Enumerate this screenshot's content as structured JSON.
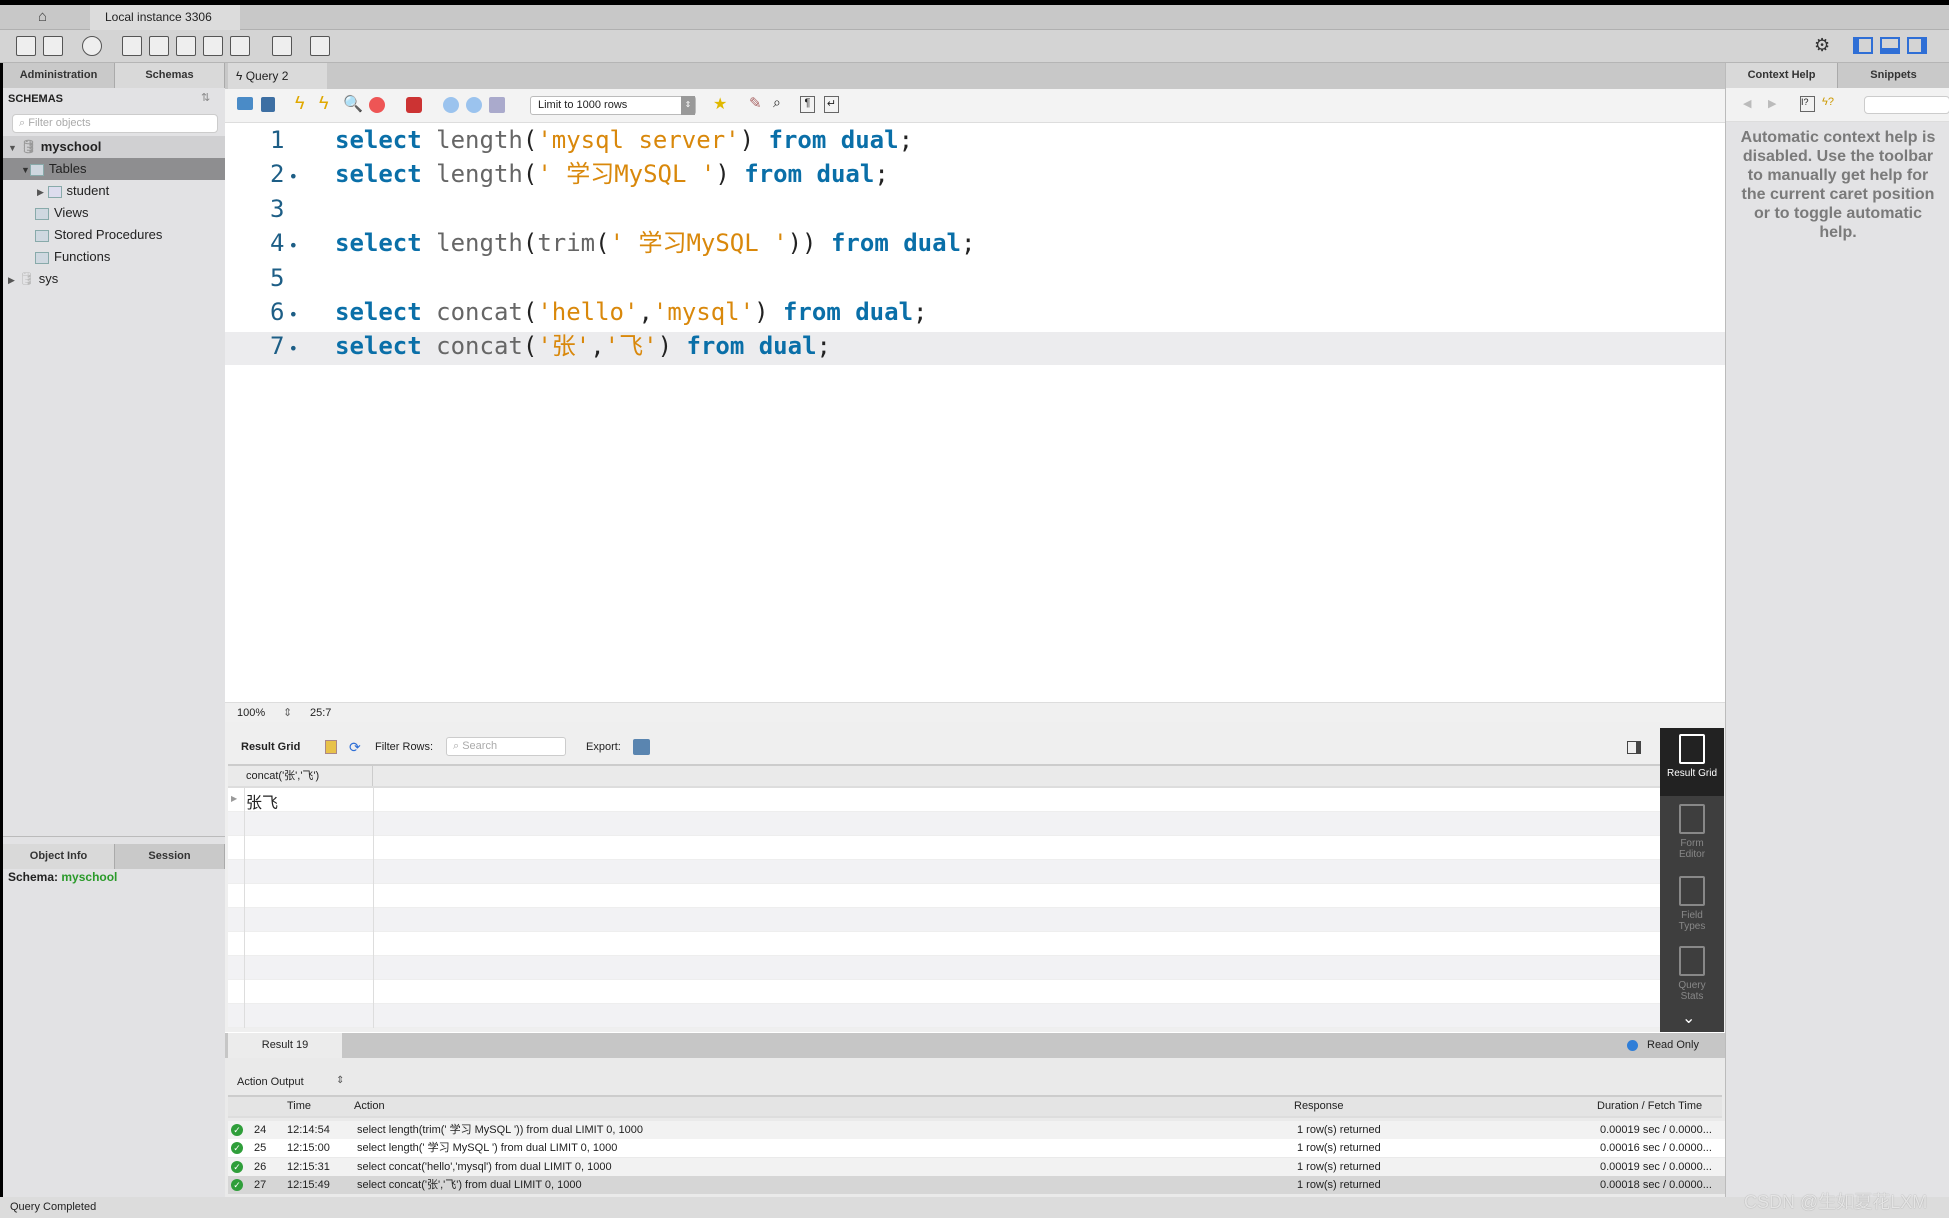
{
  "window": {
    "instance_tab": "Local instance 3306",
    "query_tab": "Query 2"
  },
  "left_panel": {
    "tabs": [
      "Administration",
      "Schemas"
    ],
    "schemas_title": "SCHEMAS",
    "filter_placeholder": "Filter objects",
    "tree": [
      {
        "label": "myschool",
        "level": 0,
        "expanded": true
      },
      {
        "label": "Tables",
        "level": 1,
        "expanded": true,
        "selected": true
      },
      {
        "label": "student",
        "level": 2
      },
      {
        "label": "Views",
        "level": 1
      },
      {
        "label": "Stored Procedures",
        "level": 1
      },
      {
        "label": "Functions",
        "level": 1
      },
      {
        "label": "sys",
        "level": 0
      }
    ],
    "bottom_tabs": [
      "Object Info",
      "Session"
    ],
    "schema_label": "Schema:",
    "schema_value": "myschool"
  },
  "sql_toolbar": {
    "limit_select": "Limit to 1000 rows"
  },
  "editor": {
    "lines": [
      {
        "n": "1",
        "dot": "",
        "tokens": [
          [
            "kw",
            "select"
          ],
          [
            "fn",
            " length"
          ],
          [
            "pu",
            "("
          ],
          [
            "st",
            "'mysql server'"
          ],
          [
            "pu",
            ") "
          ],
          [
            "kw",
            "from dual"
          ],
          [
            "pu",
            ";"
          ]
        ]
      },
      {
        "n": "2",
        "dot": "•",
        "tokens": [
          [
            "kw",
            "select"
          ],
          [
            "fn",
            " length"
          ],
          [
            "pu",
            "("
          ],
          [
            "st",
            "' 学习MySQL '"
          ],
          [
            "pu",
            ") "
          ],
          [
            "kw",
            "from dual"
          ],
          [
            "pu",
            ";"
          ]
        ]
      },
      {
        "n": "3",
        "dot": "",
        "tokens": []
      },
      {
        "n": "4",
        "dot": "•",
        "tokens": [
          [
            "kw",
            "select"
          ],
          [
            "fn",
            " length"
          ],
          [
            "pu",
            "("
          ],
          [
            "fn",
            "trim"
          ],
          [
            "pu",
            "("
          ],
          [
            "st",
            "' 学习MySQL '"
          ],
          [
            "pu",
            "))"
          ],
          [
            "kw",
            " from dual"
          ],
          [
            "pu",
            ";"
          ]
        ]
      },
      {
        "n": "5",
        "dot": "",
        "tokens": []
      },
      {
        "n": "6",
        "dot": "•",
        "tokens": [
          [
            "kw",
            "select"
          ],
          [
            "fn",
            " concat"
          ],
          [
            "pu",
            "("
          ],
          [
            "st",
            "'hello'"
          ],
          [
            "pu",
            ","
          ],
          [
            "st",
            "'mysql'"
          ],
          [
            "pu",
            ") "
          ],
          [
            "kw",
            "from dual"
          ],
          [
            "pu",
            ";"
          ]
        ]
      },
      {
        "n": "7",
        "dot": "•",
        "tokens": [
          [
            "kw",
            "select"
          ],
          [
            "fn",
            " concat"
          ],
          [
            "pu",
            "("
          ],
          [
            "st",
            "'张'"
          ],
          [
            "pu",
            ","
          ],
          [
            "st",
            "'飞'"
          ],
          [
            "pu",
            ") "
          ],
          [
            "kw",
            "from dual"
          ],
          [
            "pu",
            ";"
          ]
        ]
      }
    ],
    "zoom": "100%",
    "cursor": "25:7"
  },
  "result": {
    "toolbar_label": "Result Grid",
    "filter_label": "Filter Rows:",
    "search_placeholder": "Search",
    "export_label": "Export:",
    "column": "concat('张','飞')",
    "rows": [
      "张飞"
    ],
    "side": [
      "Result Grid",
      "Form Editor",
      "Field Types",
      "Query Stats"
    ],
    "tab": "Result 19",
    "read_only": "Read Only"
  },
  "output": {
    "selector": "Action Output",
    "headers": [
      "Time",
      "Action",
      "Response",
      "Duration / Fetch Time"
    ],
    "rows": [
      {
        "n": "24",
        "time": "12:14:54",
        "action": "select length(trim(' 学习 MySQL ')) from dual LIMIT 0, 1000",
        "response": "1 row(s) returned",
        "duration": "0.00019 sec / 0.0000..."
      },
      {
        "n": "25",
        "time": "12:15:00",
        "action": "select length(' 学习 MySQL ') from dual LIMIT 0, 1000",
        "response": "1 row(s) returned",
        "duration": "0.00016 sec / 0.0000..."
      },
      {
        "n": "26",
        "time": "12:15:31",
        "action": "select concat('hello','mysql') from dual LIMIT 0, 1000",
        "response": "1 row(s) returned",
        "duration": "0.00019 sec / 0.0000..."
      },
      {
        "n": "27",
        "time": "12:15:49",
        "action": "select concat('张','飞') from dual LIMIT 0, 1000",
        "response": "1 row(s) returned",
        "duration": "0.00018 sec / 0.0000..."
      }
    ]
  },
  "right_panel": {
    "tabs": [
      "Context Help",
      "Snippets"
    ],
    "help_text": "Automatic context help is disabled. Use the toolbar to manually get help for the current caret position or to toggle automatic help."
  },
  "status": {
    "text": "Query Completed"
  },
  "watermark": "CSDN @生如夏花LXM",
  "colors": {
    "keyword": "#0a6fa8",
    "string": "#d9880b",
    "success": "#2f9e3a",
    "schema": "#2a9a2a"
  }
}
